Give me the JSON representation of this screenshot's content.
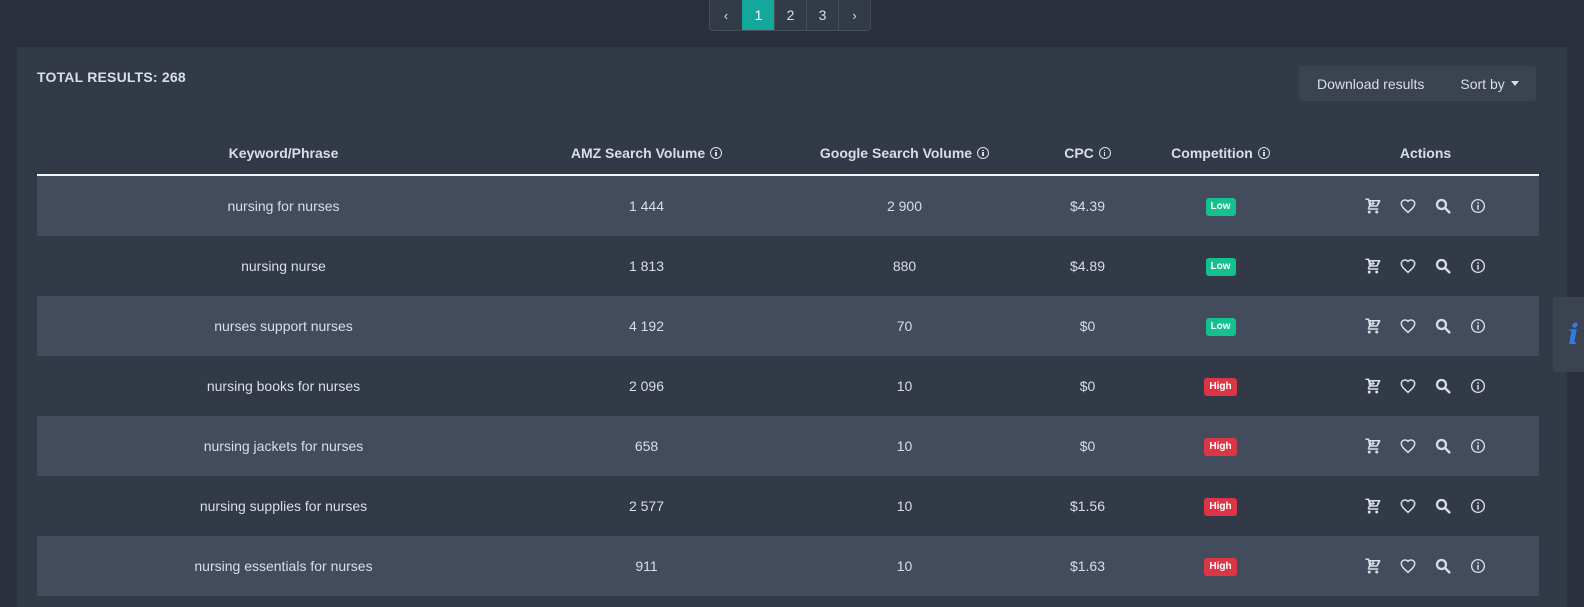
{
  "pagination": {
    "prev": "‹",
    "pages": [
      "1",
      "2",
      "3"
    ],
    "active": "1",
    "next": "›"
  },
  "summary": {
    "total_results": "TOTAL RESULTS: 268"
  },
  "toolbar": {
    "download_label": "Download results",
    "sort_label": "Sort by"
  },
  "table": {
    "headers": {
      "keyword": "Keyword/Phrase",
      "amz_volume": "AMZ Search Volume",
      "google_volume": "Google Search Volume",
      "cpc": "CPC",
      "competition": "Competition",
      "actions": "Actions"
    },
    "rows": [
      {
        "keyword": "nursing for nurses",
        "amz": "1 444",
        "google": "2 900",
        "cpc": "$4.39",
        "competition": "Low"
      },
      {
        "keyword": "nursing nurse",
        "amz": "1 813",
        "google": "880",
        "cpc": "$4.89",
        "competition": "Low"
      },
      {
        "keyword": "nurses support nurses",
        "amz": "4 192",
        "google": "70",
        "cpc": "$0",
        "competition": "Low"
      },
      {
        "keyword": "nursing books for nurses",
        "amz": "2 096",
        "google": "10",
        "cpc": "$0",
        "competition": "High"
      },
      {
        "keyword": "nursing jackets for nurses",
        "amz": "658",
        "google": "10",
        "cpc": "$0",
        "competition": "High"
      },
      {
        "keyword": "nursing supplies for nurses",
        "amz": "2 577",
        "google": "10",
        "cpc": "$1.56",
        "competition": "High"
      },
      {
        "keyword": "nursing essentials for nurses",
        "amz": "911",
        "google": "10",
        "cpc": "$1.63",
        "competition": "High"
      }
    ],
    "action_icons": [
      "cart-icon",
      "heart-icon",
      "search-icon",
      "info-icon"
    ]
  },
  "side_tab": {
    "label": "i"
  },
  "colors": {
    "accent": "#14a89c",
    "low": "#12c18d",
    "high": "#dc3545",
    "info_blue": "#2f7be5"
  }
}
